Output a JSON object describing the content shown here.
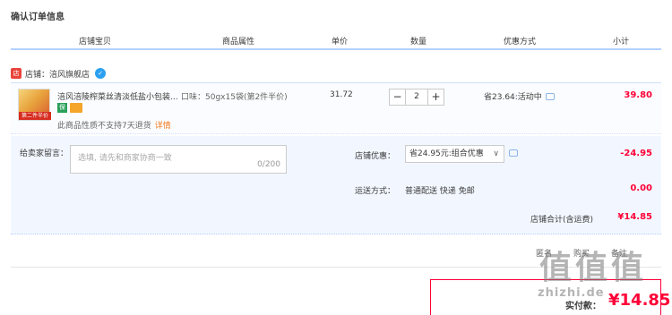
{
  "page_title": "确认订单信息",
  "columns": [
    "店铺宝贝",
    "商品属性",
    "单价",
    "数量",
    "优惠方式",
    "小计"
  ],
  "shop": {
    "tag": "店",
    "label": "店铺：涪风旗舰店"
  },
  "item": {
    "title": "涪风涪陵榨菜丝清淡低盐小包装...",
    "sku": "口味：50gx15袋(第2件半价)",
    "price": "31.72",
    "quantity": "2",
    "minus": "−",
    "plus": "+",
    "promo": "省23.64:活动中",
    "subtotal": "39.80",
    "note": "此商品性质不支持7天退货",
    "note_link": "详情",
    "thumb_badge": "第二件半价"
  },
  "message": {
    "label": "给卖家留言：",
    "placeholder": "选填, 请先和商家协商一致",
    "count": "0/200"
  },
  "discount": {
    "label": "店铺优惠：",
    "selected": "省24.95元:组合优惠",
    "amount": "-24.95"
  },
  "shipping": {
    "label": "运送方式：",
    "method": "普通配送 快递 免邮",
    "fee": "0.00"
  },
  "shop_total": {
    "label": "店铺合计(含运费)",
    "value": "¥14.85"
  },
  "footer_ops": [
    "匿名",
    "购买",
    "备注"
  ],
  "pay": {
    "label": "实付款：",
    "amount": "¥14.85"
  },
  "watermark": {
    "big": "值值值",
    "url": "zhizhi.de"
  },
  "colors": {
    "accent_red": "#ff0036",
    "header_line": "#b2d1ff",
    "panel_bg": "#f2f7ff"
  }
}
